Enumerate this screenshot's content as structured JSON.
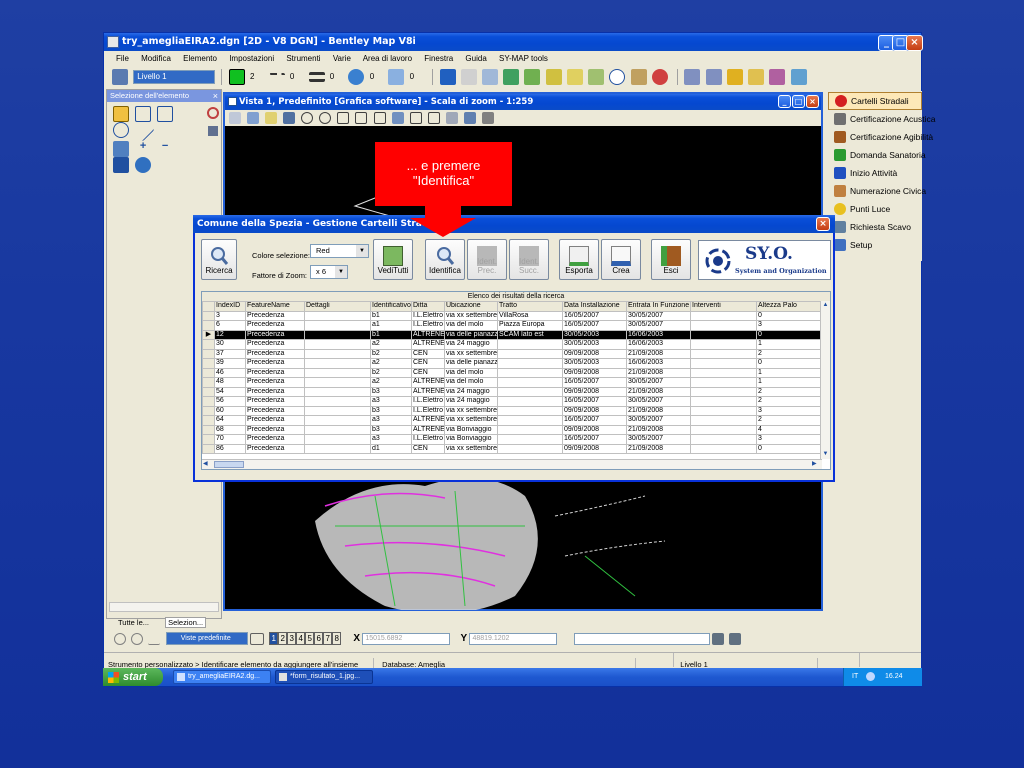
{
  "app": {
    "title": "try_amegliaEIRA2.dgn [2D - V8 DGN] - Bentley Map V8i",
    "menu": [
      "File",
      "Modifica",
      "Elemento",
      "Impostazioni",
      "Strumenti",
      "Varie",
      "Area di lavoro",
      "Finestra",
      "Guida",
      "SY-MAP tools"
    ],
    "toolbar": {
      "level": "Livello 1",
      "color_idx": "2",
      "style_idx": "0",
      "weight_idx": "0",
      "trans": "0",
      "prio": "0"
    }
  },
  "left_panel": {
    "title": "Selezione dell'elemento",
    "tab1": "Tutte le...",
    "tab2": "Selezion..."
  },
  "view": {
    "title": "Vista 1, Predefinito [Grafica software] - Scala di zoom - 1:259"
  },
  "callout": {
    "line1": "... e premere",
    "line2": "\"Identifica\""
  },
  "right_panel": {
    "items": [
      {
        "label": "Cartelli Stradali",
        "color": "#d42020"
      },
      {
        "label": "Certificazione Acustica",
        "color": "#707070"
      },
      {
        "label": "Certificazione Agibilità",
        "color": "#a05a20"
      },
      {
        "label": "Domanda Sanatoria",
        "color": "#2a9a30"
      },
      {
        "label": "Inizio Attività",
        "color": "#2050c0"
      },
      {
        "label": "Numerazione Civica",
        "color": "#c08040"
      },
      {
        "label": "Punti Luce",
        "color": "#e8c020"
      },
      {
        "label": "Richiesta Scavo",
        "color": "#6080a0"
      },
      {
        "label": "Setup",
        "color": "#4070c0"
      }
    ]
  },
  "dialog": {
    "title": "Comune della Spezia - Gestione Cartelli Stradali",
    "buttons": {
      "ricerca": "Ricerca",
      "veditutti": "VediTutti",
      "identifica": "Identifica",
      "identprec": "Ident. Prec.",
      "identsucc": "Ident. Succ.",
      "esporta": "Esporta",
      "crea": "Crea",
      "esci": "Esci"
    },
    "colore_label": "Colore selezione:",
    "colore_value": "Red",
    "zoom_label": "Fattore di Zoom:",
    "zoom_value": "x 6",
    "logo_text": "SY.O.",
    "logo_sub": "System and Organization",
    "grid_caption": "Elenco dei risultati della ricerca",
    "columns": [
      "IndexID",
      "FeatureName",
      "Dettagli",
      "Identificativo",
      "Ditta",
      "Ubicazione",
      "Tratto",
      "Data Installazione",
      "Entrata In Funzione",
      "Interventi",
      "Altezza Palo"
    ],
    "rows": [
      [
        "3",
        "Precedenza",
        "",
        "b1",
        "I.L.Elettro",
        "via xx settembre",
        "VillaRosa",
        "16/05/2007",
        "30/05/2007",
        "",
        "0"
      ],
      [
        "6",
        "Precedenza",
        "",
        "a1",
        "I.L.Elettro",
        "via del molo",
        "Piazza Europa",
        "16/05/2007",
        "30/05/2007",
        "",
        "3"
      ],
      [
        "12",
        "Precedenza",
        "",
        "b1",
        "ALTRENER",
        "via delle pianazze",
        "SCAM lato est",
        "30/05/2003",
        "16/06/2003",
        "",
        "0"
      ],
      [
        "30",
        "Precedenza",
        "",
        "a2",
        "ALTRENER",
        "via 24 maggio",
        "",
        "30/05/2003",
        "16/06/2003",
        "",
        "1"
      ],
      [
        "37",
        "Precedenza",
        "",
        "b2",
        "CEN",
        "via xx settembre",
        "",
        "09/09/2008",
        "21/09/2008",
        "",
        "2"
      ],
      [
        "39",
        "Precedenza",
        "",
        "a2",
        "CEN",
        "via delle pianazze",
        "",
        "30/05/2003",
        "16/06/2003",
        "",
        "0"
      ],
      [
        "46",
        "Precedenza",
        "",
        "b2",
        "CEN",
        "via del molo",
        "",
        "09/09/2008",
        "21/09/2008",
        "",
        "1"
      ],
      [
        "48",
        "Precedenza",
        "",
        "a2",
        "ALTRENER",
        "via del molo",
        "",
        "16/05/2007",
        "30/05/2007",
        "",
        "1"
      ],
      [
        "54",
        "Precedenza",
        "",
        "b3",
        "ALTRENER",
        "via 24 maggio",
        "",
        "09/09/2008",
        "21/09/2008",
        "",
        "2"
      ],
      [
        "56",
        "Precedenza",
        "",
        "a3",
        "I.L.Elettro",
        "via 24 maggio",
        "",
        "16/05/2007",
        "30/05/2007",
        "",
        "2"
      ],
      [
        "60",
        "Precedenza",
        "",
        "b3",
        "I.L.Elettro",
        "via xx settembre",
        "",
        "09/09/2008",
        "21/09/2008",
        "",
        "3"
      ],
      [
        "64",
        "Precedenza",
        "",
        "a3",
        "ALTRENER",
        "via xx settembre",
        "",
        "16/05/2007",
        "30/05/2007",
        "",
        "2"
      ],
      [
        "68",
        "Precedenza",
        "",
        "b3",
        "ALTRENER",
        "via Bonviaggio",
        "",
        "09/09/2008",
        "21/09/2008",
        "",
        "4"
      ],
      [
        "70",
        "Precedenza",
        "",
        "a3",
        "I.L.Elettro",
        "via Bonviaggio",
        "",
        "16/05/2007",
        "30/05/2007",
        "",
        "3"
      ],
      [
        "86",
        "Precedenza",
        "",
        "d1",
        "CEN",
        "via xx settembre",
        "",
        "09/09/2008",
        "21/09/2008",
        "",
        "0"
      ]
    ],
    "selected_row": 2
  },
  "bottom": {
    "views_label": "Viste predefinite",
    "view_numbers": [
      "1",
      "2",
      "3",
      "4",
      "5",
      "6",
      "7",
      "8"
    ],
    "x_label": "X",
    "x_value": "15015.6892",
    "y_label": "Y",
    "y_value": "48819.1202",
    "status_prompt": "Strumento personalizzato > Identificare elemento da aggiungere all'insieme",
    "database": "Database: Ameglia",
    "level": "Livello 1"
  },
  "taskbar": {
    "start": "start",
    "tasks": [
      "try_amegliaEIRA2.dg...",
      "*form_risultato_1.jpg..."
    ],
    "lang": "IT",
    "clock": "16.24"
  }
}
